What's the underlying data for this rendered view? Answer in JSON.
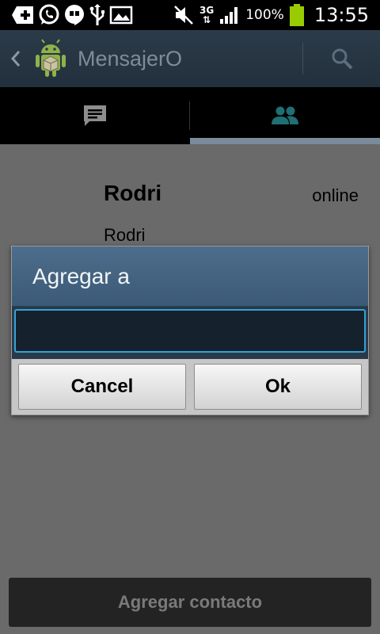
{
  "status_bar": {
    "battery_percent": "100%",
    "network_type": "3G",
    "time": "13:55",
    "icons": [
      "add-icon",
      "whatsapp-icon",
      "hangouts-icon",
      "usb-icon",
      "gallery-icon",
      "mute-icon",
      "network-3g-icon",
      "signal-icon",
      "battery-icon"
    ]
  },
  "action_bar": {
    "app_title": "MensajerO",
    "icons": [
      "back-icon",
      "app-logo-icon",
      "search-icon"
    ]
  },
  "tabs": [
    {
      "icon": "chat-icon",
      "selected": false
    },
    {
      "icon": "contacts-icon",
      "selected": true
    }
  ],
  "contact": {
    "name": "Rodri",
    "status": "online",
    "subtitle": "Rodri"
  },
  "dialog": {
    "title": "Agregar a",
    "input_value": "",
    "cancel_label": "Cancel",
    "ok_label": "Ok"
  },
  "bottom_button": {
    "label": "Agregar contacto"
  },
  "colors": {
    "accent": "#33b5e5",
    "action_bar": "#2c3b49",
    "dim_background": "#6a6a6a"
  }
}
